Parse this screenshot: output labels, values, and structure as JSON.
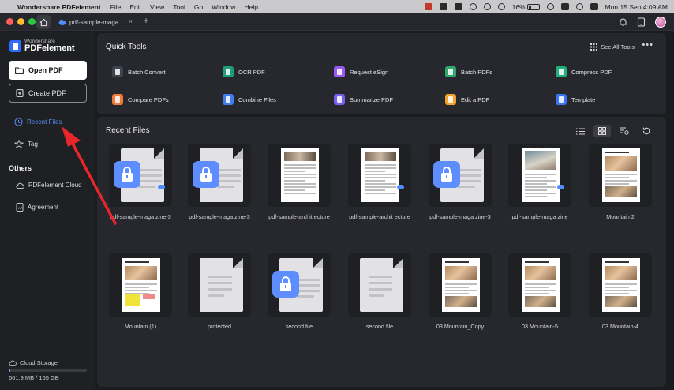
{
  "menubar": {
    "app_name": "Wondershare PDFelement",
    "items": [
      "File",
      "Edit",
      "View",
      "Tool",
      "Go",
      "Window",
      "Help"
    ],
    "battery": "16%",
    "datetime": "Mon 15 Sep  4:09 AM"
  },
  "tabbar": {
    "doc_tab": "pdf-sample-maga...",
    "close": "×",
    "add": "+"
  },
  "sidebar": {
    "brand_top": "Wondershare",
    "brand_name": "PDFelement",
    "open_pdf": "Open PDF",
    "create_pdf": "Create PDF",
    "recent_files": "Recent Files",
    "tag": "Tag",
    "others_heading": "Others",
    "pdfelement_cloud": "PDFelement Cloud",
    "agreement": "Agreement",
    "cloud_storage": "Cloud Storage",
    "storage_text": "661.9 MB / 165 GB",
    "storage_fraction": 0.004
  },
  "quick_tools": {
    "title": "Quick Tools",
    "see_all": "See All Tools",
    "more": "•••",
    "tools": [
      {
        "label": "Batch Convert",
        "color": "#3c4450"
      },
      {
        "label": "OCR PDF",
        "color": "#1e9e7a"
      },
      {
        "label": "Request eSign",
        "color": "#9a5bf0"
      },
      {
        "label": "Batch PDFs",
        "color": "#2fa86b"
      },
      {
        "label": "Compress PDF",
        "color": "#22b07e"
      },
      {
        "label": "Compare PDFs",
        "color": "#f07a3a"
      },
      {
        "label": "Combine Files",
        "color": "#3f7df0"
      },
      {
        "label": "Summarize PDF",
        "color": "#7a5cf0"
      },
      {
        "label": "Edit a PDF",
        "color": "#f3a12c"
      },
      {
        "label": "Template",
        "color": "#3a73f0"
      }
    ]
  },
  "recent": {
    "title": "Recent Files",
    "files": [
      {
        "name": "pdf-sample-maga zine-3",
        "kind": "locked",
        "cloud": true
      },
      {
        "name": "pdf-sample-maga zine-3",
        "kind": "locked",
        "cloud": false
      },
      {
        "name": "pdf-sample-archit ecture",
        "kind": "arch",
        "cloud": false
      },
      {
        "name": "pdf-sample-archit ecture",
        "kind": "arch",
        "cloud": true
      },
      {
        "name": "pdf-sample-maga zine-3",
        "kind": "locked",
        "cloud": false
      },
      {
        "name": "pdf-sample-maga zine",
        "kind": "mag",
        "cloud": true
      },
      {
        "name": "Mountain 2",
        "kind": "mountain",
        "cloud": false
      },
      {
        "name": "Mountain (1)",
        "kind": "mountain-hl",
        "cloud": false
      },
      {
        "name": "protected",
        "kind": "blank",
        "cloud": false
      },
      {
        "name": "second file",
        "kind": "locked",
        "cloud": false
      },
      {
        "name": "second file",
        "kind": "blank",
        "cloud": false
      },
      {
        "name": "03 Mountain_Copy",
        "kind": "mountain",
        "cloud": false
      },
      {
        "name": "03 Mountain-5",
        "kind": "mountain",
        "cloud": false
      },
      {
        "name": "03 Mountain-4",
        "kind": "mountain",
        "cloud": false
      }
    ]
  }
}
